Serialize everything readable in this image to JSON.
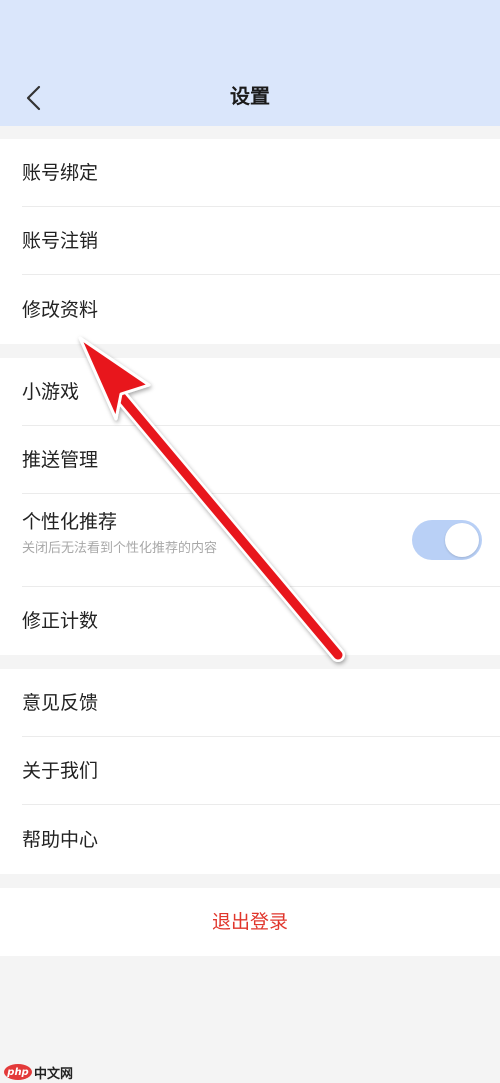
{
  "header": {
    "title": "设置",
    "back_icon": "chevron-left-icon"
  },
  "group1": {
    "items": [
      {
        "label": "账号绑定"
      },
      {
        "label": "账号注销"
      },
      {
        "label": "修改资料"
      }
    ]
  },
  "group2": {
    "items": [
      {
        "label": "小游戏"
      },
      {
        "label": "推送管理"
      },
      {
        "label": "个性化推荐",
        "sub": "关闭后无法看到个性化推荐的内容",
        "toggle_on": true
      },
      {
        "label": "修正计数"
      }
    ]
  },
  "group3": {
    "items": [
      {
        "label": "意见反馈"
      },
      {
        "label": "关于我们"
      },
      {
        "label": "帮助中心"
      }
    ]
  },
  "logout": {
    "label": "退出登录"
  },
  "watermark": {
    "badge": "php",
    "text": "中文网"
  },
  "colors": {
    "header_bg": "#dae6fb",
    "page_bg": "#f4f4f4",
    "toggle_on": "#b9d0f6",
    "logout_text": "#e0362c",
    "arrow": "#e8141b"
  }
}
